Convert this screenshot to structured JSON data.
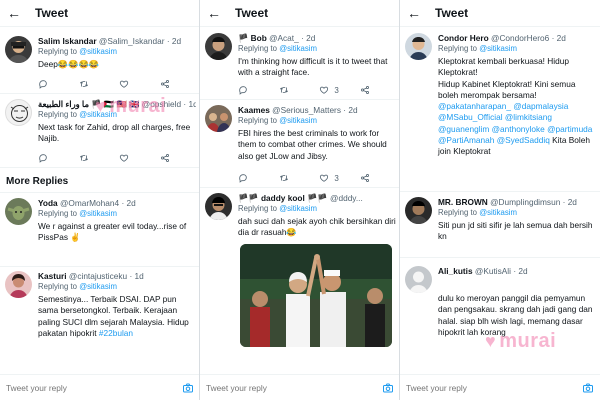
{
  "panels": [
    {
      "header": {
        "title": "Tweet"
      },
      "tweets": [
        {
          "name": "Salim Iskandar",
          "handle": "@Salim_Iskandar",
          "time": "· 2d",
          "replying_label": "Replying to",
          "replying_to": "@sitikasim",
          "text": "Deep😂😂😂😂",
          "likes": ""
        },
        {
          "name": "ما وراء الطبيعة 🏴 🇵🇸 🇲🇾 🇬🇧",
          "handle": "@opshield",
          "time": "· 1d",
          "replying_label": "Replying to",
          "replying_to": "@sitikasim",
          "text": "Next task for Zahid, drop all charges, free Najib.",
          "likes": ""
        }
      ],
      "section_title": "More Replies",
      "more_tweets": [
        {
          "name": "Yoda",
          "handle": "@OmarMohan4",
          "time": "· 2d",
          "replying_label": "Replying to",
          "replying_to": "@sitikasim",
          "text": "We r against a greater evil today...rise of PissPas ✌",
          "likes": ""
        },
        {
          "name": "Kasturi",
          "handle": "@cintajusticeku",
          "time": "· 1d",
          "replying_label": "Replying to",
          "replying_to": "@sitikasim",
          "text": "Semestinya... Terbaik DSAI. DAP pun sama bersetongkol. Terbaik. Kerajaan paling SUCI dlm sejarah Malaysia. Hidup pakatan hipokrit ",
          "hashtag": "#22bulan",
          "likes": ""
        }
      ],
      "composer": {
        "placeholder": "Tweet your reply"
      }
    },
    {
      "header": {
        "title": "Tweet"
      },
      "tweets": [
        {
          "name": "🏴 Bob",
          "handle": "@Acat_",
          "time": "· 2d",
          "replying_label": "Replying to",
          "replying_to": "@sitikasim",
          "text": "I'm thinking how difficult is it to tweet that with a straight face.",
          "likes": "3"
        },
        {
          "name": "Kaames",
          "handle": "@Serious_Matters",
          "time": "· 2d",
          "replying_label": "Replying to",
          "replying_to": "@sitikasim",
          "text": "FBI hires the best criminals to work for them to combat other crimes. We should also get JLow and Jibsy.",
          "likes": "3"
        },
        {
          "name": "🏴🏴 daddy kool 🏴🏴",
          "handle": "@dddy...",
          "time": "",
          "replying_label": "Replying to",
          "replying_to": "@sitikasim",
          "text": "dah suci dah sejak ayoh chik bersihkan diri dia dr rasuah😂",
          "likes": ""
        }
      ],
      "composer": {
        "placeholder": "Tweet your reply"
      }
    },
    {
      "header": {
        "title": "Tweet"
      },
      "tweets": [
        {
          "name": "Condor Hero",
          "handle": "@CondorHero6",
          "time": "· 2d",
          "replying_label": "Replying to",
          "replying_to": "@sitikasim",
          "text_parts": [
            "Kleptokrat kembali berkuasa! Hidup Kleptokrat!",
            "Hidup Kabinet Kleptokrat! Kini semua boleh merompak bersama! "
          ],
          "mentions": "@pakatanharapan_ @dapmalaysia @MSabu_Official @limkitsiang @guanenglim @anthonyloke @partimuda @PartiAmanah @SyedSaddiq",
          "text_tail": " Kita Boleh join Kleptokrat",
          "likes": ""
        },
        {
          "name": "MR. BROWN",
          "handle": "@Dumplingdimsun",
          "time": "· 2d",
          "replying_label": "Replying to",
          "replying_to": "@sitikasim",
          "text": "Siti pun jd siti sifir je lah semua dah bersih kn",
          "likes": ""
        },
        {
          "name": "Ali_kutis",
          "handle": "@KutisAli",
          "time": "· 2d",
          "replying_label": "",
          "replying_to": "",
          "text": "dulu ko meroyan panggil dia pemyamun dan pengsakau. skrang dah jadi gang dan halal. siap blh wish lagi, memang dasar hipokrit lah korang",
          "likes": ""
        }
      ],
      "composer": {
        "placeholder": "Tweet your reply"
      }
    }
  ],
  "watermark": {
    "text": "murai"
  },
  "colors": {
    "accent": "#1d9bf0",
    "secondary_text": "#536471",
    "watermark": "#f078aa"
  },
  "icons": [
    "back-arrow-icon",
    "reply-icon",
    "retweet-icon",
    "like-icon",
    "share-icon",
    "camera-icon"
  ]
}
